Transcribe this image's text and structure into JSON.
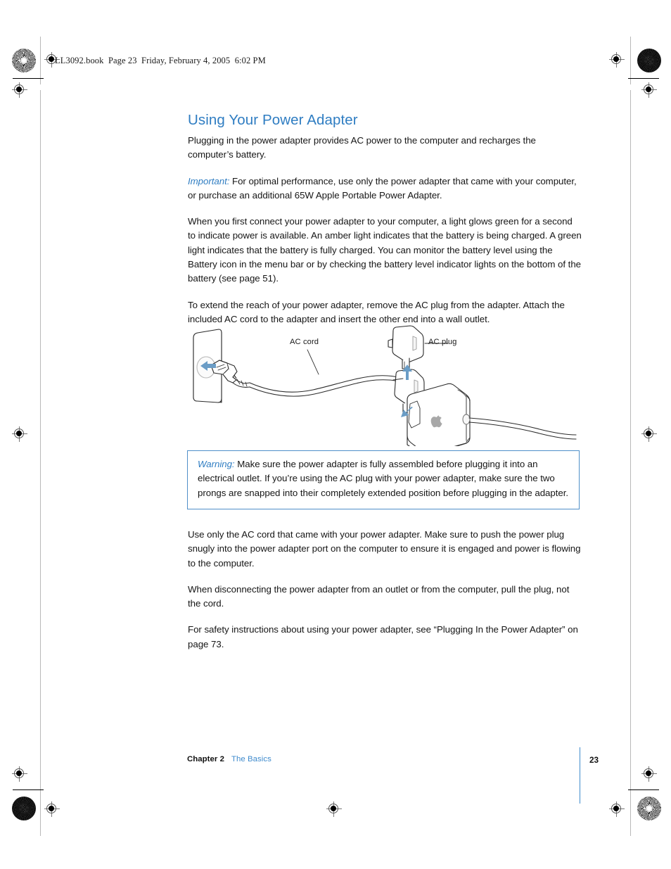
{
  "file_header": "LL3092.book  Page 23  Friday, February 4, 2005  6:02 PM",
  "section": {
    "title": "Using Your Power Adapter",
    "intro": "Plugging in the power adapter provides AC power to the computer and recharges the computer’s battery.",
    "important_label": "Important:",
    "important_text": " For optimal performance, use only the power adapter that came with your computer, or purchase an additional 65W Apple Portable Power Adapter.",
    "paragraph_light": "When you first connect your power adapter to your computer, a light glows green for a second to indicate power is available. An amber light indicates that the battery is being charged. A green light indicates that the battery is fully charged. You can monitor the battery level using the Battery icon in the menu bar or by checking the battery level indicator lights on the bottom of the battery (see page 51).",
    "paragraph_extend": "To extend the reach of your power adapter, remove the AC plug from the adapter. Attach the included AC cord to the adapter and insert the other end into a wall outlet.",
    "paragraph_use_only": "Use only the AC cord that came with your power adapter. Make sure to push the power plug snugly into the power adapter port on the computer to ensure it is engaged and power is flowing to the computer.",
    "paragraph_disconnect": "When disconnecting the power adapter from an outlet or from the computer, pull the plug, not the cord.",
    "paragraph_safety": "For safety instructions about using your power adapter, see “Plugging In the Power Adapter” on page 73."
  },
  "warning": {
    "label": "Warning:",
    "text": " Make sure the power adapter is fully assembled before plugging it into an electrical outlet. If you’re using the AC plug with your power adapter, make sure the two prongs are snapped into their completely extended position before plugging in the adapter."
  },
  "figure": {
    "label_ac_cord": "AC cord",
    "label_ac_plug": "AC plug"
  },
  "footer": {
    "chapter": "Chapter 2",
    "chapter_name": "The Basics",
    "page_number": "23"
  },
  "colors": {
    "accent_blue": "#2f7dc2",
    "footer_blue": "#3f8bcd",
    "warning_border": "#4f8fc9",
    "arrow_blue": "#6b9dc6",
    "line_gray": "#2b2b2b"
  }
}
